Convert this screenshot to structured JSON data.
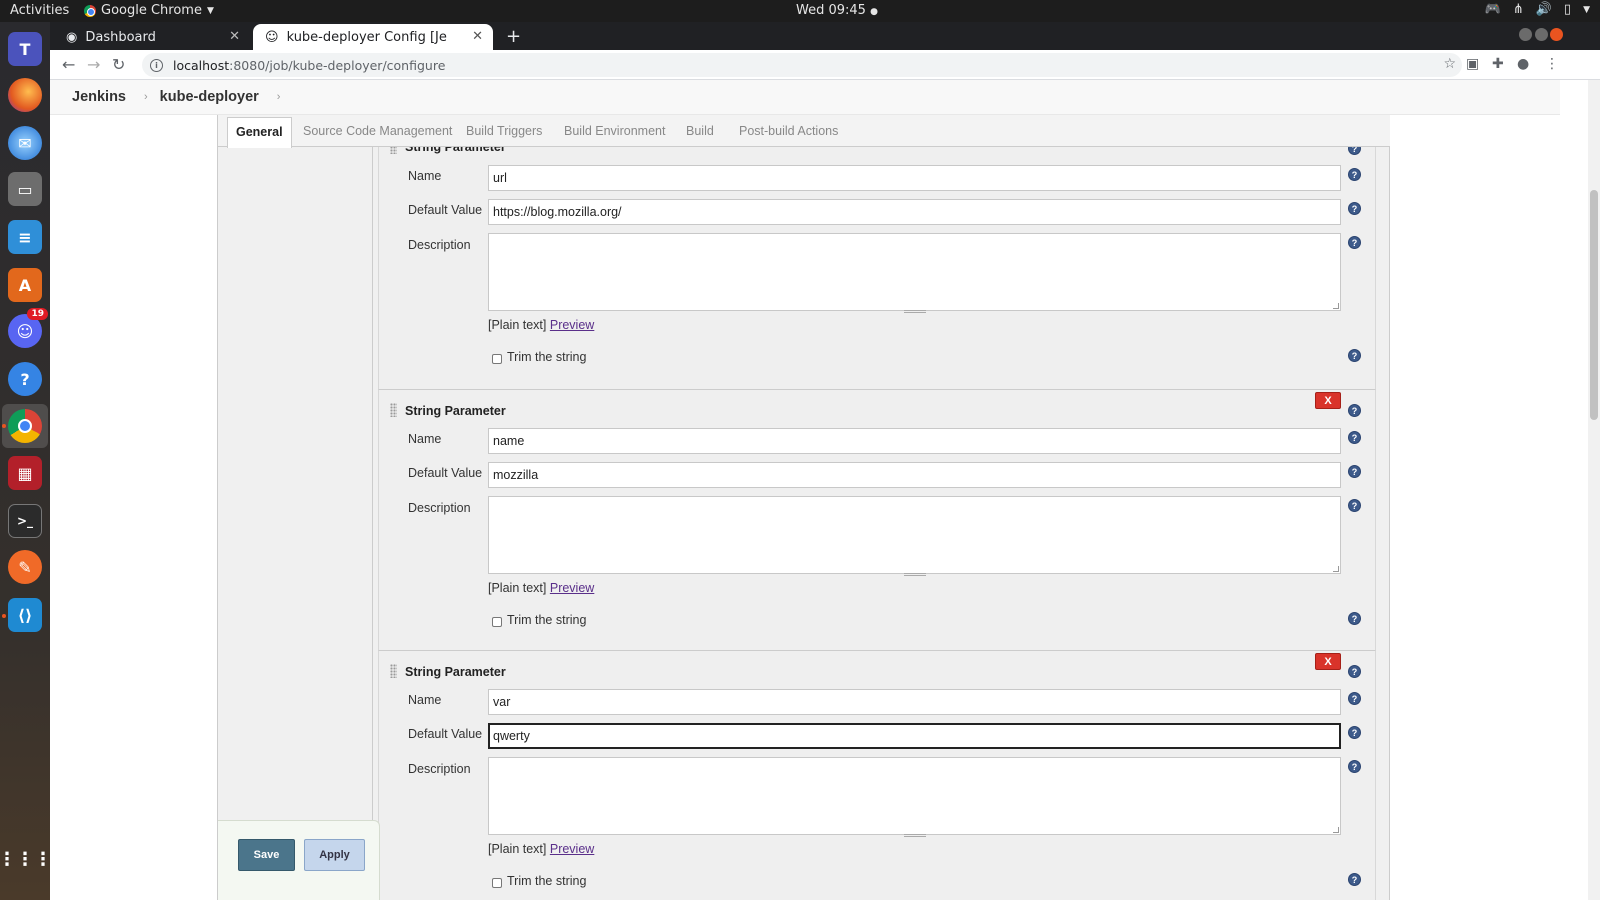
{
  "desktop": {
    "activities": "Activities",
    "app_name": "Google Chrome",
    "clock": "Wed 09:45",
    "dock_badge": "19"
  },
  "browser": {
    "tabs": [
      {
        "title": "Dashboard"
      },
      {
        "title": "kube-deployer Config [Je"
      }
    ],
    "url_host": "localhost",
    "url_path": ":8080/job/kube-deployer/configure"
  },
  "breadcrumb": {
    "root": "Jenkins",
    "job": "kube-deployer"
  },
  "config_tabs": [
    "General",
    "Source Code Management",
    "Build Triggers",
    "Build Environment",
    "Build",
    "Post-build Actions"
  ],
  "labels": {
    "section": "String Parameter",
    "name": "Name",
    "default_value": "Default Value",
    "description": "Description",
    "plain_text": "[Plain text]",
    "preview": "Preview",
    "trim": "Trim the string",
    "delete": "X",
    "help": "?"
  },
  "parameters": [
    {
      "name": "url",
      "default_value": "https://blog.mozilla.org/",
      "description": ""
    },
    {
      "name": "name",
      "default_value": "mozzilla",
      "description": ""
    },
    {
      "name": "var",
      "default_value": "qwerty",
      "description": ""
    }
  ],
  "buttons": {
    "save": "Save",
    "apply": "Apply"
  }
}
